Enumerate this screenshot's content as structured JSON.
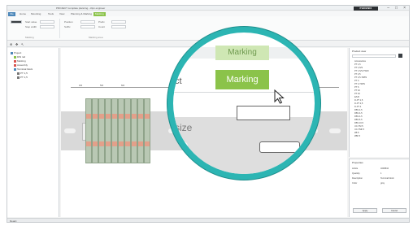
{
  "window": {
    "title": "PROJECT complete planning - clipx engineer",
    "brand": "PHOENIX",
    "controls": [
      "–",
      "□",
      "×"
    ]
  },
  "menu": {
    "tabs": [
      "File",
      "Home",
      "Mounting",
      "Tools",
      "View",
      "Planning & Marking",
      "Marking"
    ]
  },
  "ribbon": {
    "groups": [
      "Marking",
      "Marking area"
    ],
    "labels": [
      "Start value",
      "Step width",
      "Position",
      "Prefix",
      "Suffix",
      "Count"
    ]
  },
  "left_tree": {
    "items": [
      "Project",
      "DIN rail",
      "Marking",
      "Assembly",
      "Terminal block",
      "PT 1,5",
      "PT 1,5"
    ]
  },
  "ruler": {
    "labels": [
      "400",
      "500",
      "600"
    ]
  },
  "magnifier": {
    "tab_hover": "Marking",
    "tab_active": "Marking",
    "left_text": "ct",
    "size_text": "size"
  },
  "right_panel": {
    "title": "Product view",
    "rows": [
      "Accessories",
      "PT 1,5",
      "PT 1,5/S",
      "PT 1,5/S-TWIN",
      "PT 2,5",
      "PT 2,5-TWIN",
      "PT 4",
      "PT 4-TWIN",
      "PT 6",
      "PT 10",
      "PT 16",
      "E/UK",
      "D-PT 1,5",
      "D-PT 2,5",
      "D-PT 4",
      "FBS 2-5",
      "FBS 3-5",
      "FBS 4-5",
      "FBS 5-5",
      "FBS 10-5",
      "UC-TM 5",
      "UC-TMF 5",
      "ZB 5",
      "ZBF 5"
    ],
    "props_title": "Properties",
    "props": [
      "Article",
      "Quantity",
      "Description",
      "Color"
    ],
    "props_values": [
      "3209510",
      "1",
      "Terminal block",
      "gray"
    ],
    "btn_apply": "Apply",
    "btn_cancel": "Cancel"
  },
  "statusbar": {
    "text": "Ready"
  },
  "colors": {
    "accent_green": "#8bc34a",
    "magnifier_ring": "#2cb5b3",
    "brand_bg": "#2b2f33"
  }
}
